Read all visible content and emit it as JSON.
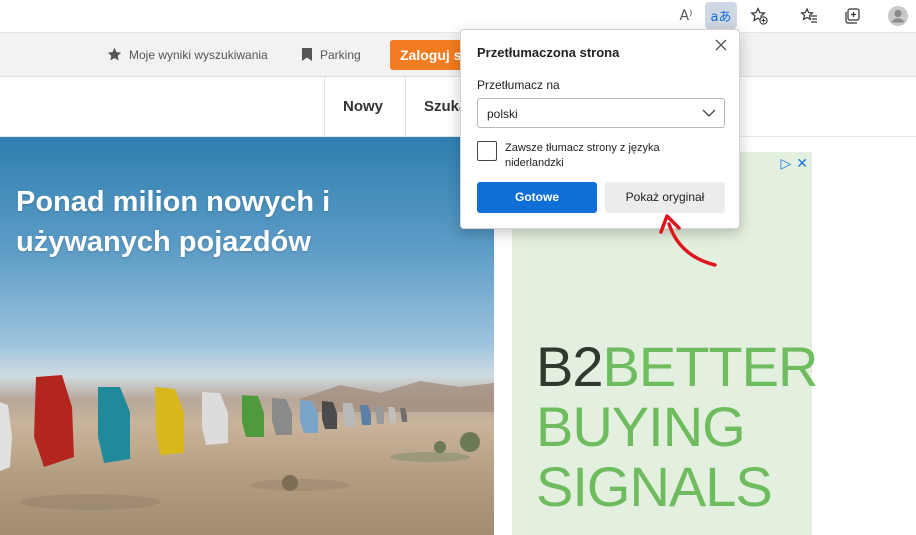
{
  "browser": {
    "read_aloud_icon": "read-aloud-icon",
    "translate_icon": "translate-icon",
    "add_favorite_icon": "add-favorite-icon",
    "favorites_icon": "favorites-icon",
    "collections_icon": "collections-icon",
    "profile_icon": "profile-icon",
    "read_aloud_glyph": "A⁾",
    "translate_glyph": "aあ"
  },
  "site_top": {
    "saved_searches": "Moje wyniki wyszukiwania",
    "parking": "Parking",
    "login": "Zaloguj się"
  },
  "site_nav": {
    "items": [
      "Nowy",
      "Szukaj"
    ]
  },
  "hero": {
    "title": "Ponad milion nowych i używanych pojazdów"
  },
  "ad": {
    "line1_prefix": "B2",
    "line1_rest": "BETTER",
    "line2": "BUYING",
    "line3": "SIGNALS",
    "adchoices_glyph": "▷",
    "close_glyph": "✕"
  },
  "translate_popup": {
    "title": "Przetłumaczona strona",
    "translate_to_label": "Przetłumacz na",
    "selected_language": "polski",
    "always_translate_label": "Zawsze tłumacz strony z języka niderlandzki",
    "always_translate_checked": false,
    "done_button": "Gotowe",
    "show_original_button": "Pokaż oryginał"
  },
  "colors": {
    "accent_blue": "#0f6fd6",
    "login_orange": "#f47c20",
    "ad_green": "#6fbc5f",
    "annotation_red": "#e0151c"
  }
}
